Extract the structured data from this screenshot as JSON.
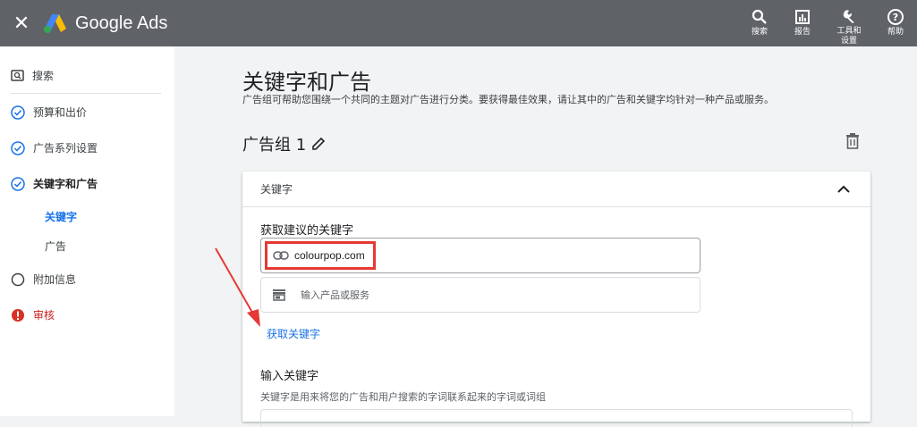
{
  "topbar": {
    "brand": "Google Ads",
    "actions": [
      {
        "label": "搜索",
        "icon": "search-icon"
      },
      {
        "label": "报告",
        "icon": "reports-icon"
      },
      {
        "label": "工具和\n设置",
        "icon": "wrench-icon"
      },
      {
        "label": "帮助",
        "icon": "help-icon"
      }
    ]
  },
  "sidebar": {
    "search": "搜索",
    "items": [
      {
        "label": "预算和出价",
        "status": "done"
      },
      {
        "label": "广告系列设置",
        "status": "done"
      },
      {
        "label": "关键字和广告",
        "status": "current"
      },
      {
        "label": "附加信息",
        "status": "empty"
      },
      {
        "label": "审核",
        "status": "error"
      }
    ],
    "sub_items": [
      "关键字",
      "广告"
    ]
  },
  "main": {
    "title": "关键字和广告",
    "subtitle": "广告组可帮助您围绕一个共同的主题对广告进行分类。要获得最佳效果，请让其中的广告和关键字均针对一种产品或服务。",
    "group_title": "广告组 1"
  },
  "card": {
    "header": "关键字",
    "suggest_label": "获取建议的关键字",
    "url_value": "colourpop.com",
    "product_placeholder": "输入产品或服务",
    "get_keywords": "获取关键字",
    "enter_label": "输入关键字",
    "enter_hint": "关键字是用来将您的广告和用户搜索的字词联系起来的字词或词组"
  },
  "colors": {
    "topbar": "#5f6368",
    "accent": "#1a73e8",
    "highlight": "#e53935",
    "error": "#d93025"
  }
}
